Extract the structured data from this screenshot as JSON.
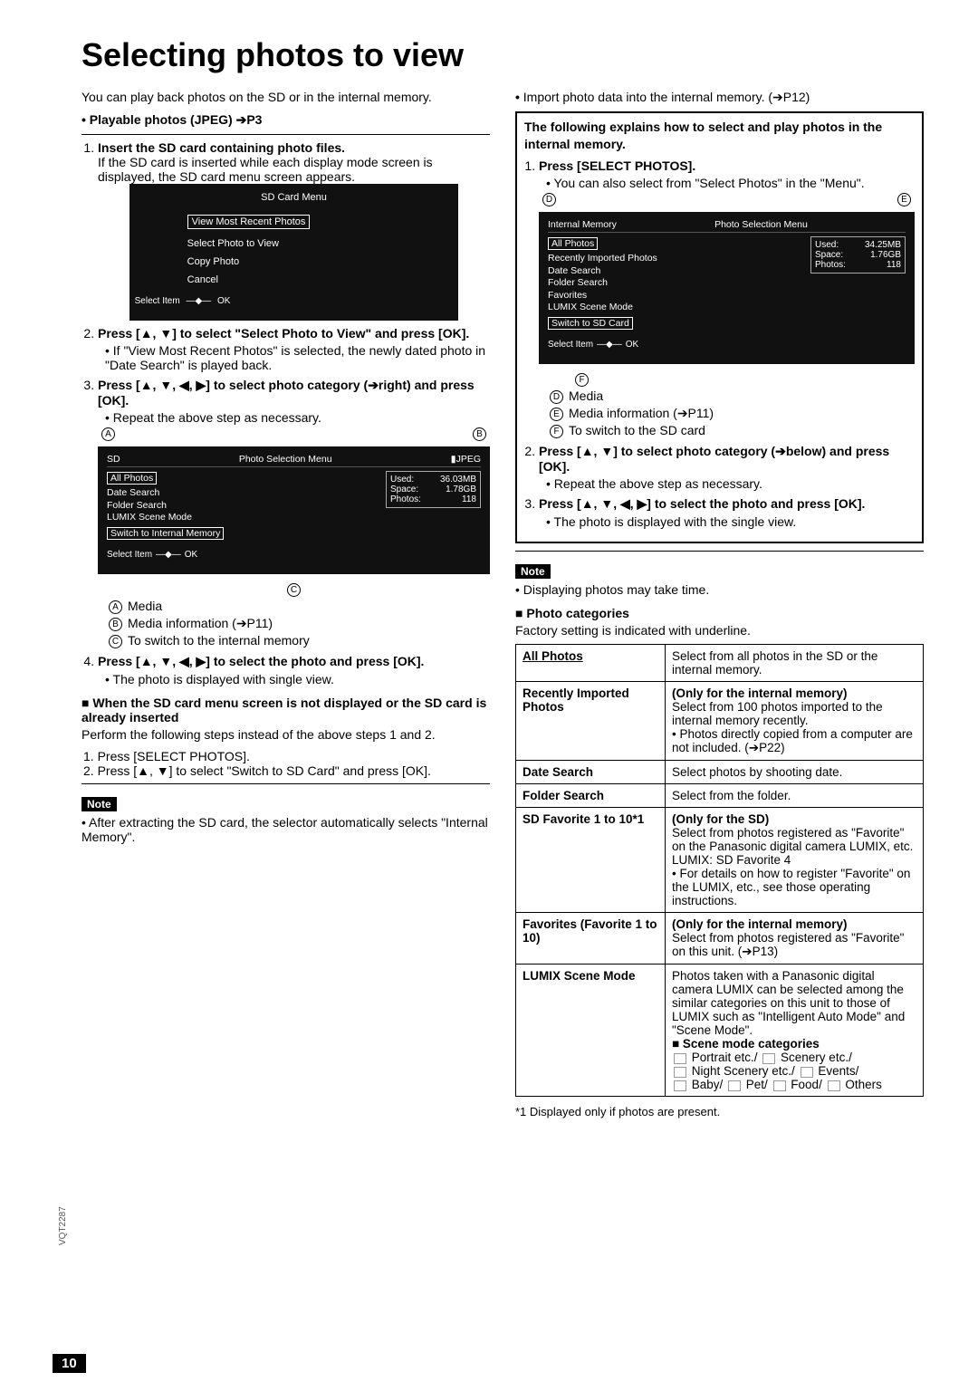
{
  "title": "Selecting photos to view",
  "intro": "You can play back photos on the SD or in the internal memory.",
  "playable": "Playable photos (JPEG) ➔P3",
  "left_steps": {
    "s1": "Insert the SD card containing photo files.",
    "s1_body": "If the SD card is inserted while each display mode screen is displayed, the SD card menu screen appears.",
    "sd_menu_title": "SD Card Menu",
    "sd_menu_items": [
      "View Most Recent Photos",
      "Select Photo to View",
      "Copy Photo",
      "Cancel"
    ],
    "nav_sel": "Select Item",
    "nav_ok": "OK",
    "s2": "Press [▲, ▼] to select \"Select Photo to View\" and press [OK].",
    "s2_b": "If \"View Most Recent Photos\" is selected, the newly dated photo in \"Date Search\" is played back.",
    "s3": "Press [▲, ▼, ◀, ▶] to select photo category (➔right) and press [OK].",
    "s3_b": "Repeat the above step as necessary.",
    "psel_title": "Photo Selection Menu",
    "psel_media": "SD",
    "psel_jpeg": "▮JPEG",
    "psel_list": [
      "All Photos",
      "Date Search",
      "Folder Search",
      "LUMIX Scene Mode",
      "Switch to Internal Memory"
    ],
    "psel_stats": {
      "Used": "36.03MB",
      "Space": "1.78GB",
      "Photos": "118"
    },
    "marks_sd": {
      "A": "Media",
      "B": "Media information (➔P11)",
      "C": "To switch to the internal memory"
    },
    "s4": "Press [▲, ▼, ◀, ▶] to select the photo and press [OK].",
    "s4_b": "The photo is displayed with single view."
  },
  "left_when": {
    "heading": "When the SD card menu screen is not displayed or the SD card is already inserted",
    "body": "Perform the following steps instead of the above steps 1 and 2.",
    "l1": "Press [SELECT PHOTOS].",
    "l2": "Press [▲, ▼] to select \"Switch to SD Card\" and press [OK]."
  },
  "left_note": "After extracting the SD card, the selector automatically selects \"Internal Memory\".",
  "right_import": "Import photo data into the internal memory. (➔P12)",
  "right_box_intro": "The following explains how to select and play photos in the internal memory.",
  "right_box": {
    "s1": "Press [SELECT PHOTOS].",
    "s1_b": "You can also select from \"Select Photos\" in the \"Menu\".",
    "psel_media": "Internal Memory",
    "psel_title": "Photo Selection Menu",
    "psel_list": [
      "All Photos",
      "Recently Imported Photos",
      "Date Search",
      "Folder Search",
      "Favorites",
      "LUMIX Scene Mode",
      "Switch to SD Card"
    ],
    "psel_stats": {
      "Used": "34.25MB",
      "Space": "1.76GB",
      "Photos": "118"
    },
    "marks_im": {
      "D": "Media",
      "E": "Media information (➔P11)",
      "F": "To switch to the SD card"
    },
    "s2": "Press [▲, ▼] to select photo category (➔below) and press [OK].",
    "s2_b": "Repeat the above step as necessary.",
    "s3": "Press [▲, ▼, ◀, ▶] to select the photo and press [OK].",
    "s3_b": "The photo is displayed with the single view."
  },
  "right_note": "Displaying photos may take time.",
  "cat_heading": "Photo categories",
  "cat_sub": "Factory setting is indicated with underline.",
  "categories": [
    {
      "name": "All Photos",
      "underline": true,
      "desc": "Select from all photos in the SD or the internal memory."
    },
    {
      "name": "Recently Imported Photos",
      "desc_bold": "(Only for the internal memory)",
      "desc": "Select from 100 photos imported to the internal memory recently.",
      "desc_bul": "Photos directly copied from a computer are not included. (➔P22)"
    },
    {
      "name": "Date Search",
      "desc": "Select photos by shooting date."
    },
    {
      "name": "Folder Search",
      "desc": "Select from the folder."
    },
    {
      "name": "SD Favorite 1 to 10*1",
      "desc_bold": "(Only for the SD)",
      "desc": "Select from photos registered as \"Favorite\" on the Panasonic digital camera LUMIX, etc.\nLUMIX: SD Favorite 4",
      "desc_bul": "For details on how to register \"Favorite\" on the LUMIX, etc., see those operating instructions."
    },
    {
      "name": "Favorites (Favorite 1 to 10)",
      "desc_bold": "(Only for the internal memory)",
      "desc": "Select from photos registered as \"Favorite\" on this unit. (➔P13)"
    },
    {
      "name": "LUMIX Scene Mode",
      "desc": "Photos taken with a Panasonic digital camera LUMIX can be selected among the similar categories on this unit to those of LUMIX such as \"Intelligent Auto Mode\" and \"Scene Mode\".",
      "scene_heading": "Scene mode categories",
      "scene_cats": "Portrait etc./ Scenery etc./ Night Scenery etc./ Events/ Baby/ Pet/ Food/ Others"
    }
  ],
  "footnote": "*1 Displayed only if photos are present.",
  "page_number": "10",
  "vcode": "VQT2287"
}
